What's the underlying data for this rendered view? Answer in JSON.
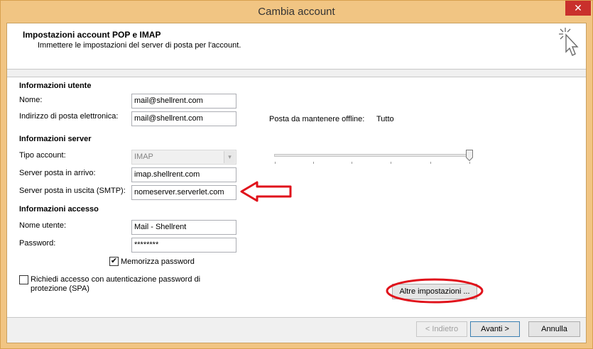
{
  "window": {
    "title": "Cambia account",
    "close_symbol": "✕"
  },
  "header": {
    "title": "Impostazioni account POP e IMAP",
    "subtitle": "Immettere le impostazioni del server di posta per l'account."
  },
  "user_info": {
    "section": "Informazioni utente",
    "name_label": "Nome:",
    "name_value": "mail@shellrent.com",
    "email_label": "Indirizzo di posta elettronica:",
    "email_value": "mail@shellrent.com"
  },
  "server_info": {
    "section": "Informazioni server",
    "account_type_label": "Tipo account:",
    "account_type_value": "IMAP",
    "incoming_label": "Server posta in arrivo:",
    "incoming_value": "imap.shellrent.com",
    "outgoing_label": "Server posta in uscita (SMTP):",
    "outgoing_value": "nomeserver.serverlet.com"
  },
  "logon_info": {
    "section": "Informazioni accesso",
    "username_label": "Nome utente:",
    "username_value": "Mail - Shellrent",
    "password_label": "Password:",
    "password_value": "********",
    "remember_label": "Memorizza password",
    "remember_checked": true
  },
  "spa": {
    "label": "Richiedi accesso con autenticazione password di protezione (SPA)",
    "checked": false
  },
  "offline": {
    "label": "Posta da mantenere offline:",
    "value": "Tutto",
    "slider_level": 1.0
  },
  "buttons": {
    "more_settings": "Altre impostazioni ...",
    "back": "< Indietro",
    "next": "Avanti >",
    "cancel": "Annulla"
  },
  "colors": {
    "annotation": "#e0121b",
    "title_bar": "#f1c583"
  },
  "icons": {
    "header": "cursor-click-icon",
    "dropdown": "chevron-down-icon",
    "check": "checkmark-icon"
  }
}
